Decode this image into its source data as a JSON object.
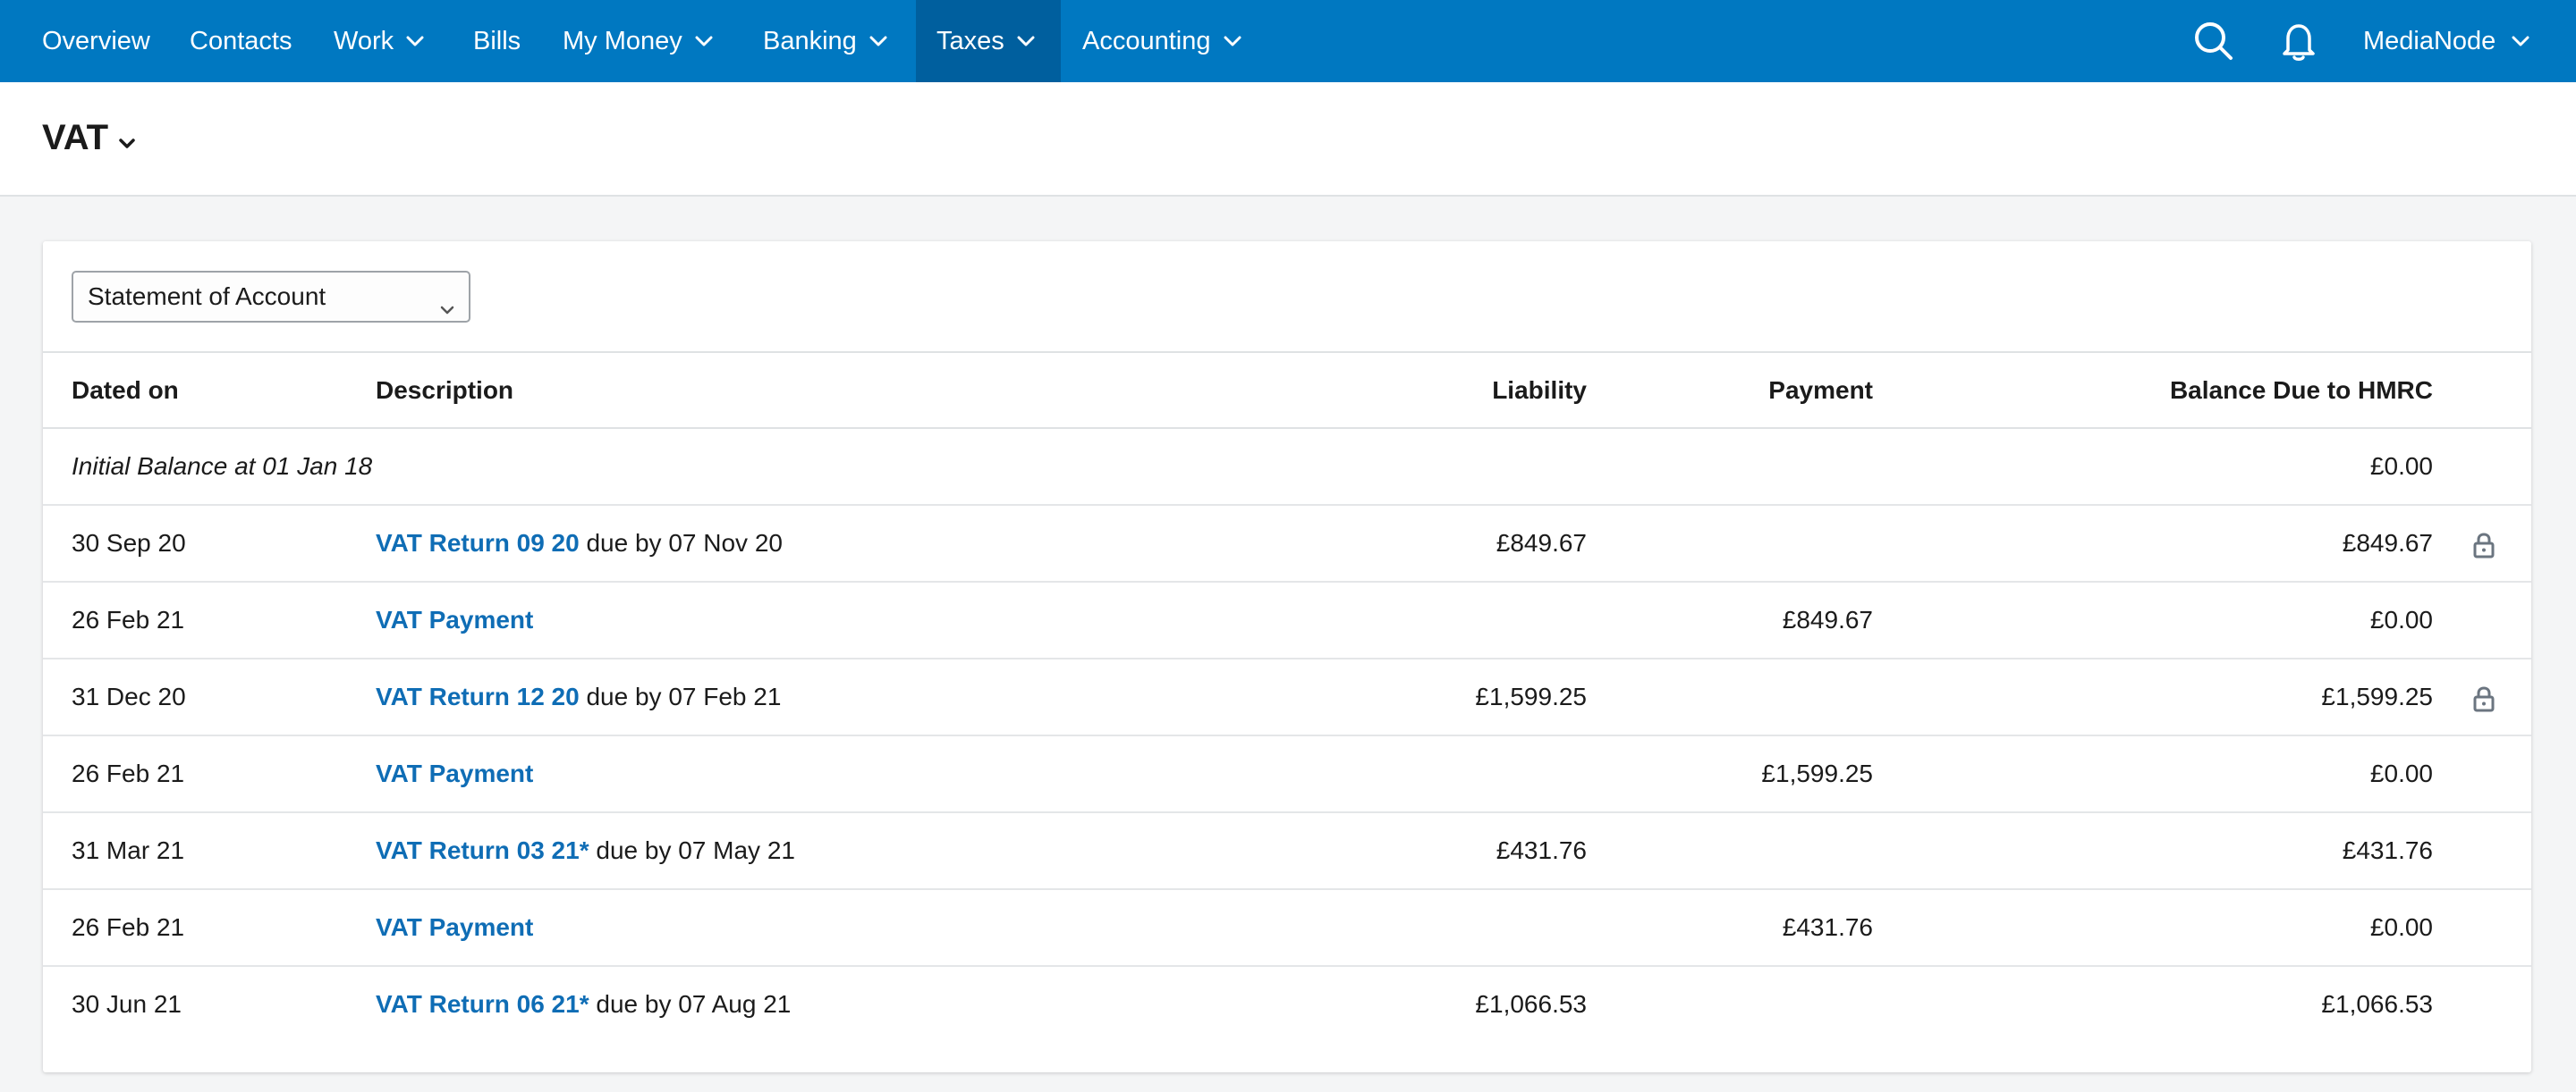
{
  "nav": {
    "items": [
      {
        "label": "Overview",
        "has_dropdown": false,
        "active": false
      },
      {
        "label": "Contacts",
        "has_dropdown": false,
        "active": false
      },
      {
        "label": "Work",
        "has_dropdown": true,
        "active": false
      },
      {
        "label": "Bills",
        "has_dropdown": false,
        "active": false
      },
      {
        "label": "My Money",
        "has_dropdown": true,
        "active": false
      },
      {
        "label": "Banking",
        "has_dropdown": true,
        "active": false
      },
      {
        "label": "Taxes",
        "has_dropdown": true,
        "active": true
      },
      {
        "label": "Accounting",
        "has_dropdown": true,
        "active": false
      }
    ],
    "icons": [
      "search-icon",
      "bell-icon"
    ],
    "company": "MediaNode"
  },
  "page": {
    "title": "VAT"
  },
  "statement": {
    "select_value": "Statement of Account",
    "columns": {
      "date": "Dated on",
      "description": "Description",
      "liability": "Liability",
      "payment": "Payment",
      "balance": "Balance Due to HMRC"
    },
    "initial": {
      "label": "Initial Balance at 01 Jan 18",
      "balance": "£0.00"
    },
    "rows": [
      {
        "date": "30 Sep 20",
        "link": "VAT Return 09 20",
        "suffix": " due by 07 Nov 20",
        "liability": "£849.67",
        "payment": "",
        "balance": "£849.67",
        "locked": true
      },
      {
        "date": "26 Feb 21",
        "link": "VAT Payment",
        "suffix": "",
        "liability": "",
        "payment": "£849.67",
        "balance": "£0.00",
        "locked": false
      },
      {
        "date": "31 Dec 20",
        "link": "VAT Return 12 20",
        "suffix": " due by 07 Feb 21",
        "liability": "£1,599.25",
        "payment": "",
        "balance": "£1,599.25",
        "locked": true
      },
      {
        "date": "26 Feb 21",
        "link": "VAT Payment",
        "suffix": "",
        "liability": "",
        "payment": "£1,599.25",
        "balance": "£0.00",
        "locked": false
      },
      {
        "date": "31 Mar 21",
        "link": "VAT Return 03 21*",
        "suffix": " due by 07 May 21",
        "liability": "£431.76",
        "payment": "",
        "balance": "£431.76",
        "locked": false
      },
      {
        "date": "26 Feb 21",
        "link": "VAT Payment",
        "suffix": "",
        "liability": "",
        "payment": "£431.76",
        "balance": "£0.00",
        "locked": false
      },
      {
        "date": "30 Jun 21",
        "link": "VAT Return 06 21*",
        "suffix": " due by 07 Aug 21",
        "liability": "£1,066.53",
        "payment": "",
        "balance": "£1,066.53",
        "locked": false
      }
    ]
  },
  "colors": {
    "nav_bg": "#0078c1",
    "nav_active": "#005f9e",
    "link": "#0f6db5"
  }
}
